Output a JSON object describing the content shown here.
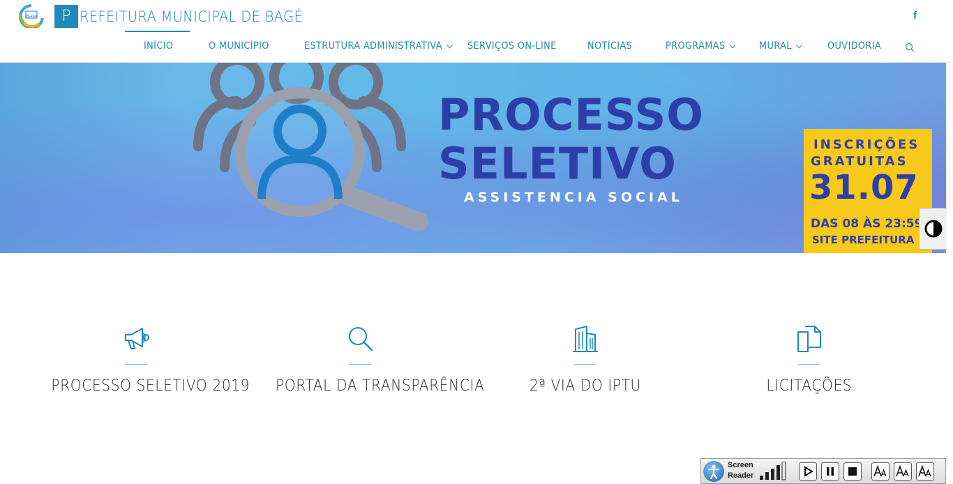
{
  "header": {
    "brand_letter": "P",
    "brand_rest": "REFEITURA MUNICIPAL DE BAGÉ",
    "facebook": "f",
    "logo_text": "Bagé"
  },
  "nav": {
    "items": [
      {
        "label": "INÍCIO",
        "has_submenu": false,
        "active": true
      },
      {
        "label": "O MUNICÍPIO",
        "has_submenu": false
      },
      {
        "label": "ESTRUTURA ADMINISTRATIVA",
        "has_submenu": true
      },
      {
        "label": "SERVIÇOS ON-LINE",
        "has_submenu": false
      },
      {
        "label": "NOTÍCIAS",
        "has_submenu": false
      },
      {
        "label": "PROGRAMAS",
        "has_submenu": true
      },
      {
        "label": "MURAL",
        "has_submenu": true
      },
      {
        "label": "OUVIDORIA",
        "has_submenu": false
      }
    ],
    "search_icon": "search-icon"
  },
  "banner": {
    "title_line1": "PROCESSO",
    "title_line2": "SELETIVO",
    "subtitle": "ASSISTENCIA SOCIAL",
    "promo_line1": "INSCRIÇÕES",
    "promo_line2": "GRATUITAS",
    "promo_date": "31.07",
    "promo_line3": "DAS 08 ÀS 23:59",
    "promo_line4": "SITE PREFEITURA"
  },
  "quick_links": [
    {
      "label": "PROCESSO SELETIVO 2019",
      "icon": "megaphone-icon"
    },
    {
      "label": "PORTAL DA TRANSPARÊNCIA",
      "icon": "search-icon"
    },
    {
      "label": "2ª VIA DO IPTU",
      "icon": "building-icon"
    },
    {
      "label": "LICITAÇÕES",
      "icon": "documents-icon"
    }
  ],
  "screen_reader": {
    "label_line1": "Screen",
    "label_line2": "Reader"
  },
  "colors": {
    "primary": "#1e8bb8",
    "banner_title": "#2d3fa6",
    "promo_bg": "#f7c91b"
  }
}
